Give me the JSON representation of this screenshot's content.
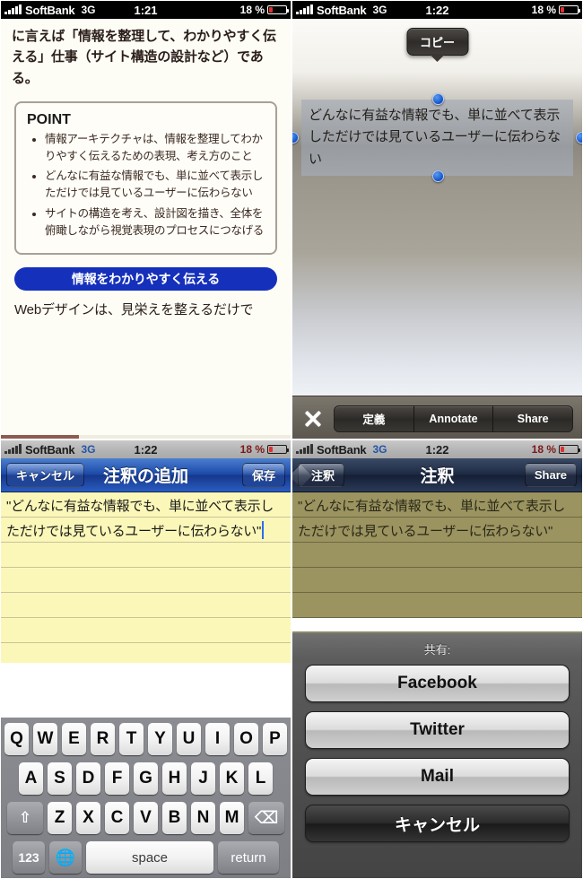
{
  "panels": {
    "reader": {
      "status": {
        "carrier": "SoftBank",
        "network": "3G",
        "time": "1:21",
        "battery_pct": "18 %"
      },
      "body_top": "に言えば「情報を整理して、わかりやすく伝える」仕事（サイト構造の設計など）である。",
      "point_box": {
        "title": "POINT",
        "bullets": [
          "情報アーキテクチャは、情報を整理してわかりやすく伝えるための表現、考え方のこと",
          "どんなに有益な情報でも、単に並べて表示しただけでは見ているユーザーに伝わらない",
          "サイトの構造を考え、設計図を描き、全体を俯瞰しながら視覚表現のプロセスにつなげる"
        ]
      },
      "heading_button": "情報をわかりやすく伝える",
      "body_tail": "Webデザインは、見栄えを整えるだけで"
    },
    "selection": {
      "status": {
        "carrier": "SoftBank",
        "network": "3G",
        "time": "1:22",
        "battery_pct": "18 %"
      },
      "callout": "コピー",
      "selected_text": "どんなに有益な情報でも、単に並べて表示しただけでは見ているユーザーに伝わらない",
      "toolbar": {
        "close_icon": "close-icon",
        "items": [
          "定義",
          "Annotate",
          "Share"
        ]
      }
    },
    "editor": {
      "status": {
        "carrier": "SoftBank",
        "network": "3G",
        "time": "1:22",
        "battery_pct": "18 %"
      },
      "nav": {
        "cancel": "キャンセル",
        "title": "注釈の追加",
        "save": "保存"
      },
      "note_text": "\"どんなに有益な情報でも、単に並べて表示しただけでは見ているユーザーに伝わらない\"",
      "keyboard": {
        "row1": [
          "Q",
          "W",
          "E",
          "R",
          "T",
          "Y",
          "U",
          "I",
          "O",
          "P"
        ],
        "row2": [
          "A",
          "S",
          "D",
          "F",
          "G",
          "H",
          "J",
          "K",
          "L"
        ],
        "row3": [
          "Z",
          "X",
          "C",
          "V",
          "B",
          "N",
          "M"
        ],
        "shift": "⇧",
        "delete": "⌫",
        "numbers": "123",
        "globe": "🌐",
        "space": "space",
        "return": "return"
      }
    },
    "share": {
      "status": {
        "carrier": "SoftBank",
        "network": "3G",
        "time": "1:22",
        "battery_pct": "18 %"
      },
      "nav": {
        "back": "注釈",
        "title": "注釈",
        "share": "Share"
      },
      "note_text": "\"どんなに有益な情報でも、単に並べて表示しただけでは見ているユーザーに伝わらない\"",
      "sheet": {
        "title": "共有:",
        "buttons": [
          "Facebook",
          "Twitter",
          "Mail"
        ],
        "cancel": "キャンセル"
      }
    }
  },
  "colors": {
    "accent_blue": "#1530bb",
    "note_yellow": "#fbf7b8",
    "note_olive": "#9b9460",
    "battery_red": "#e03030"
  }
}
